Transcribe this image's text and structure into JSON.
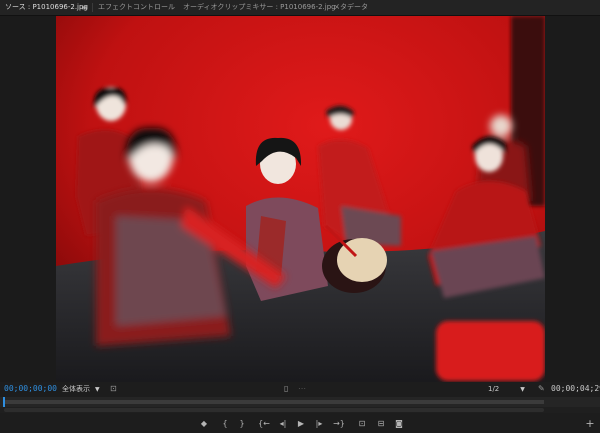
{
  "tabs": [
    {
      "label": "ソース : P1010696-2.jpg",
      "active": true
    },
    {
      "label": "エフェクトコントロール",
      "active": false
    },
    {
      "label": "オーディオクリップミキサー : P1010696-2.jpg",
      "active": false
    },
    {
      "label": "メタデータ",
      "active": false
    }
  ],
  "tab_menu_glyph": "≡",
  "viewer": {
    "timecode_in": "00;00;00;00",
    "timecode_duration": "00;00;04;29",
    "fit_label": "全体表示",
    "resolution_label": "1/2"
  },
  "icons": {
    "tab_menu": "hamburger-icon",
    "settings": "wrench-icon",
    "safe_margins": "safe-margins-icon",
    "marker": "marker-icon",
    "add": "plus-icon"
  },
  "transport": {
    "add_marker": "◆",
    "mark_in": "{",
    "mark_out": "}",
    "go_to_in": "{←",
    "step_back": "◂|",
    "play": "▶",
    "step_forward": "|▸",
    "go_to_out": "→}",
    "insert": "⊡",
    "overwrite": "⊟",
    "export_frame": "◙",
    "button_editor": "+"
  },
  "colors": {
    "accent": "#2f8fe0",
    "background": "#1d1d1d",
    "frame_red": "#d01616"
  }
}
